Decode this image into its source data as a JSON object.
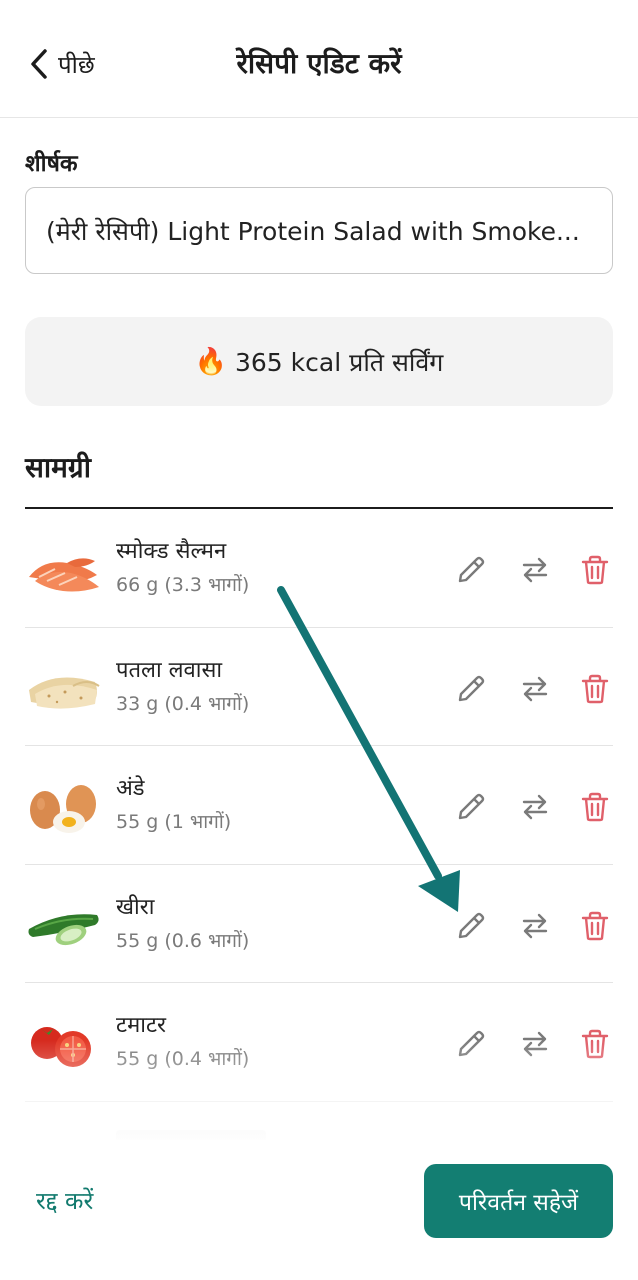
{
  "header": {
    "back_label": "पीछे",
    "title": "रेसिपी एडिट करें"
  },
  "form": {
    "title_label": "शीर्षक",
    "title_value": "(मेरी रेसिपी) Light Protein Salad with Smoke..."
  },
  "nutrition": {
    "icon": "fire-icon",
    "text": "365 kcal प्रति सर्विंग"
  },
  "ingredients": {
    "section_title": "सामग्री",
    "items": [
      {
        "name": "स्मोक्ड सैल्मन",
        "amount": "66 g (3.3 भागों)",
        "image": "salmon-image"
      },
      {
        "name": "पतला लवासा",
        "amount": "33 g (0.4 भागों)",
        "image": "lavash-image"
      },
      {
        "name": "अंडे",
        "amount": "55 g (1 भागों)",
        "image": "eggs-image"
      },
      {
        "name": "खीरा",
        "amount": "55 g (0.6 भागों)",
        "image": "cucumber-image"
      },
      {
        "name": "टमाटर",
        "amount": "55 g (0.4 भागों)",
        "image": "tomato-image"
      }
    ]
  },
  "footer": {
    "cancel_label": "रद्द करें",
    "save_label": "परिवर्तन सहेजें"
  },
  "colors": {
    "accent": "#137e72",
    "delete": "#e0606a",
    "icon_gray": "#7a7a7a",
    "annotation_arrow": "#137474"
  }
}
